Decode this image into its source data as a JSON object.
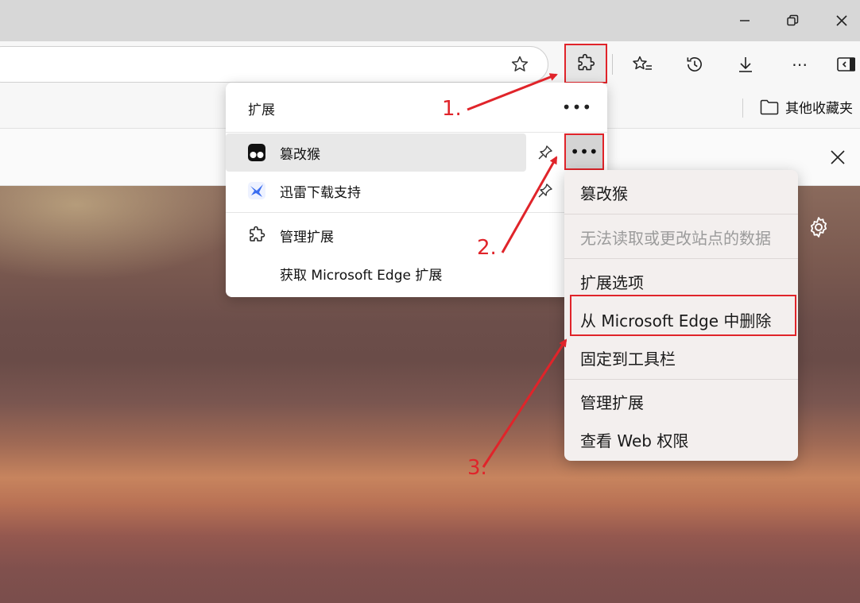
{
  "favorites_bar": {
    "folder_label": "其他收藏夹"
  },
  "extensions_panel": {
    "title": "扩展",
    "items": [
      {
        "name": "篡改猴",
        "icon": "tampermonkey-icon"
      },
      {
        "name": "迅雷下载支持",
        "icon": "thunder-icon"
      }
    ],
    "manage_label": "管理扩展",
    "get_label": "获取 Microsoft Edge 扩展"
  },
  "context_menu": {
    "header": "篡改猴",
    "disabled_item": "无法读取或更改站点的数据",
    "options": "扩展选项",
    "remove": "从 Microsoft Edge 中删除",
    "pin": "固定到工具栏",
    "manage": "管理扩展",
    "web_perms": "查看 Web 权限"
  },
  "annotations": {
    "step1": "1.",
    "step2": "2.",
    "step3": "3."
  },
  "colors": {
    "highlight": "#e0242a",
    "panel_bg": "#ffffff",
    "menu_bg": "#f3efee"
  }
}
